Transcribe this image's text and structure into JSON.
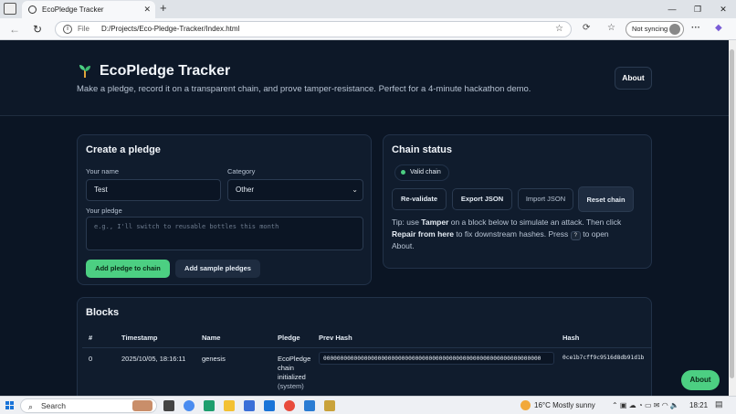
{
  "browser": {
    "tab_title": "EcoPledge Tracker",
    "address_scheme": "File",
    "address_url": "D:/Projects/Eco-Pledge-Tracker/Index.html",
    "sync_label": "Not syncing"
  },
  "header": {
    "title": "EcoPledge Tracker",
    "tagline": "Make a pledge, record it on a transparent chain, and prove tamper-resistance. Perfect for a 4-minute hackathon demo.",
    "about_label": "About"
  },
  "create": {
    "heading": "Create a pledge",
    "name_label": "Your name",
    "name_value": "Test",
    "category_label": "Category",
    "category_value": "Other",
    "pledge_label": "Your pledge",
    "pledge_placeholder": "e.g., I'll switch to reusable bottles this month",
    "add_label": "Add pledge to chain",
    "sample_label": "Add sample pledges"
  },
  "status": {
    "heading": "Chain status",
    "valid_label": "Valid chain",
    "revalidate_label": "Re-validate",
    "export_label": "Export JSON",
    "import_label": "Import JSON",
    "reset_label": "Reset chain",
    "tip": {
      "t1": "Tip: use ",
      "tamper": "Tamper",
      "t2": " on a block below to simulate an attack. Then click ",
      "repair": "Repair from here",
      "t3": " to fix downstream hashes. Press ",
      "key": "?",
      "t4": " to open About."
    }
  },
  "blocks": {
    "heading": "Blocks",
    "columns": [
      "#",
      "Timestamp",
      "Name",
      "Pledge",
      "Prev Hash",
      "Hash"
    ],
    "rows": [
      {
        "index": "0",
        "timestamp": "2025/10/05, 18:16:11",
        "name": "genesis",
        "pledge_lines": [
          "EcoPledge",
          "chain",
          "initialized",
          "(system)"
        ],
        "prev_hash": "0000000000000000000000000000000000000000000000000000000000000000",
        "hash": "0ce1b7cff9c9516d8db91d1b"
      }
    ]
  },
  "floating_about": "About",
  "taskbar": {
    "search_label": "Search",
    "weather": "16°C  Mostly sunny",
    "time": "18:21"
  }
}
